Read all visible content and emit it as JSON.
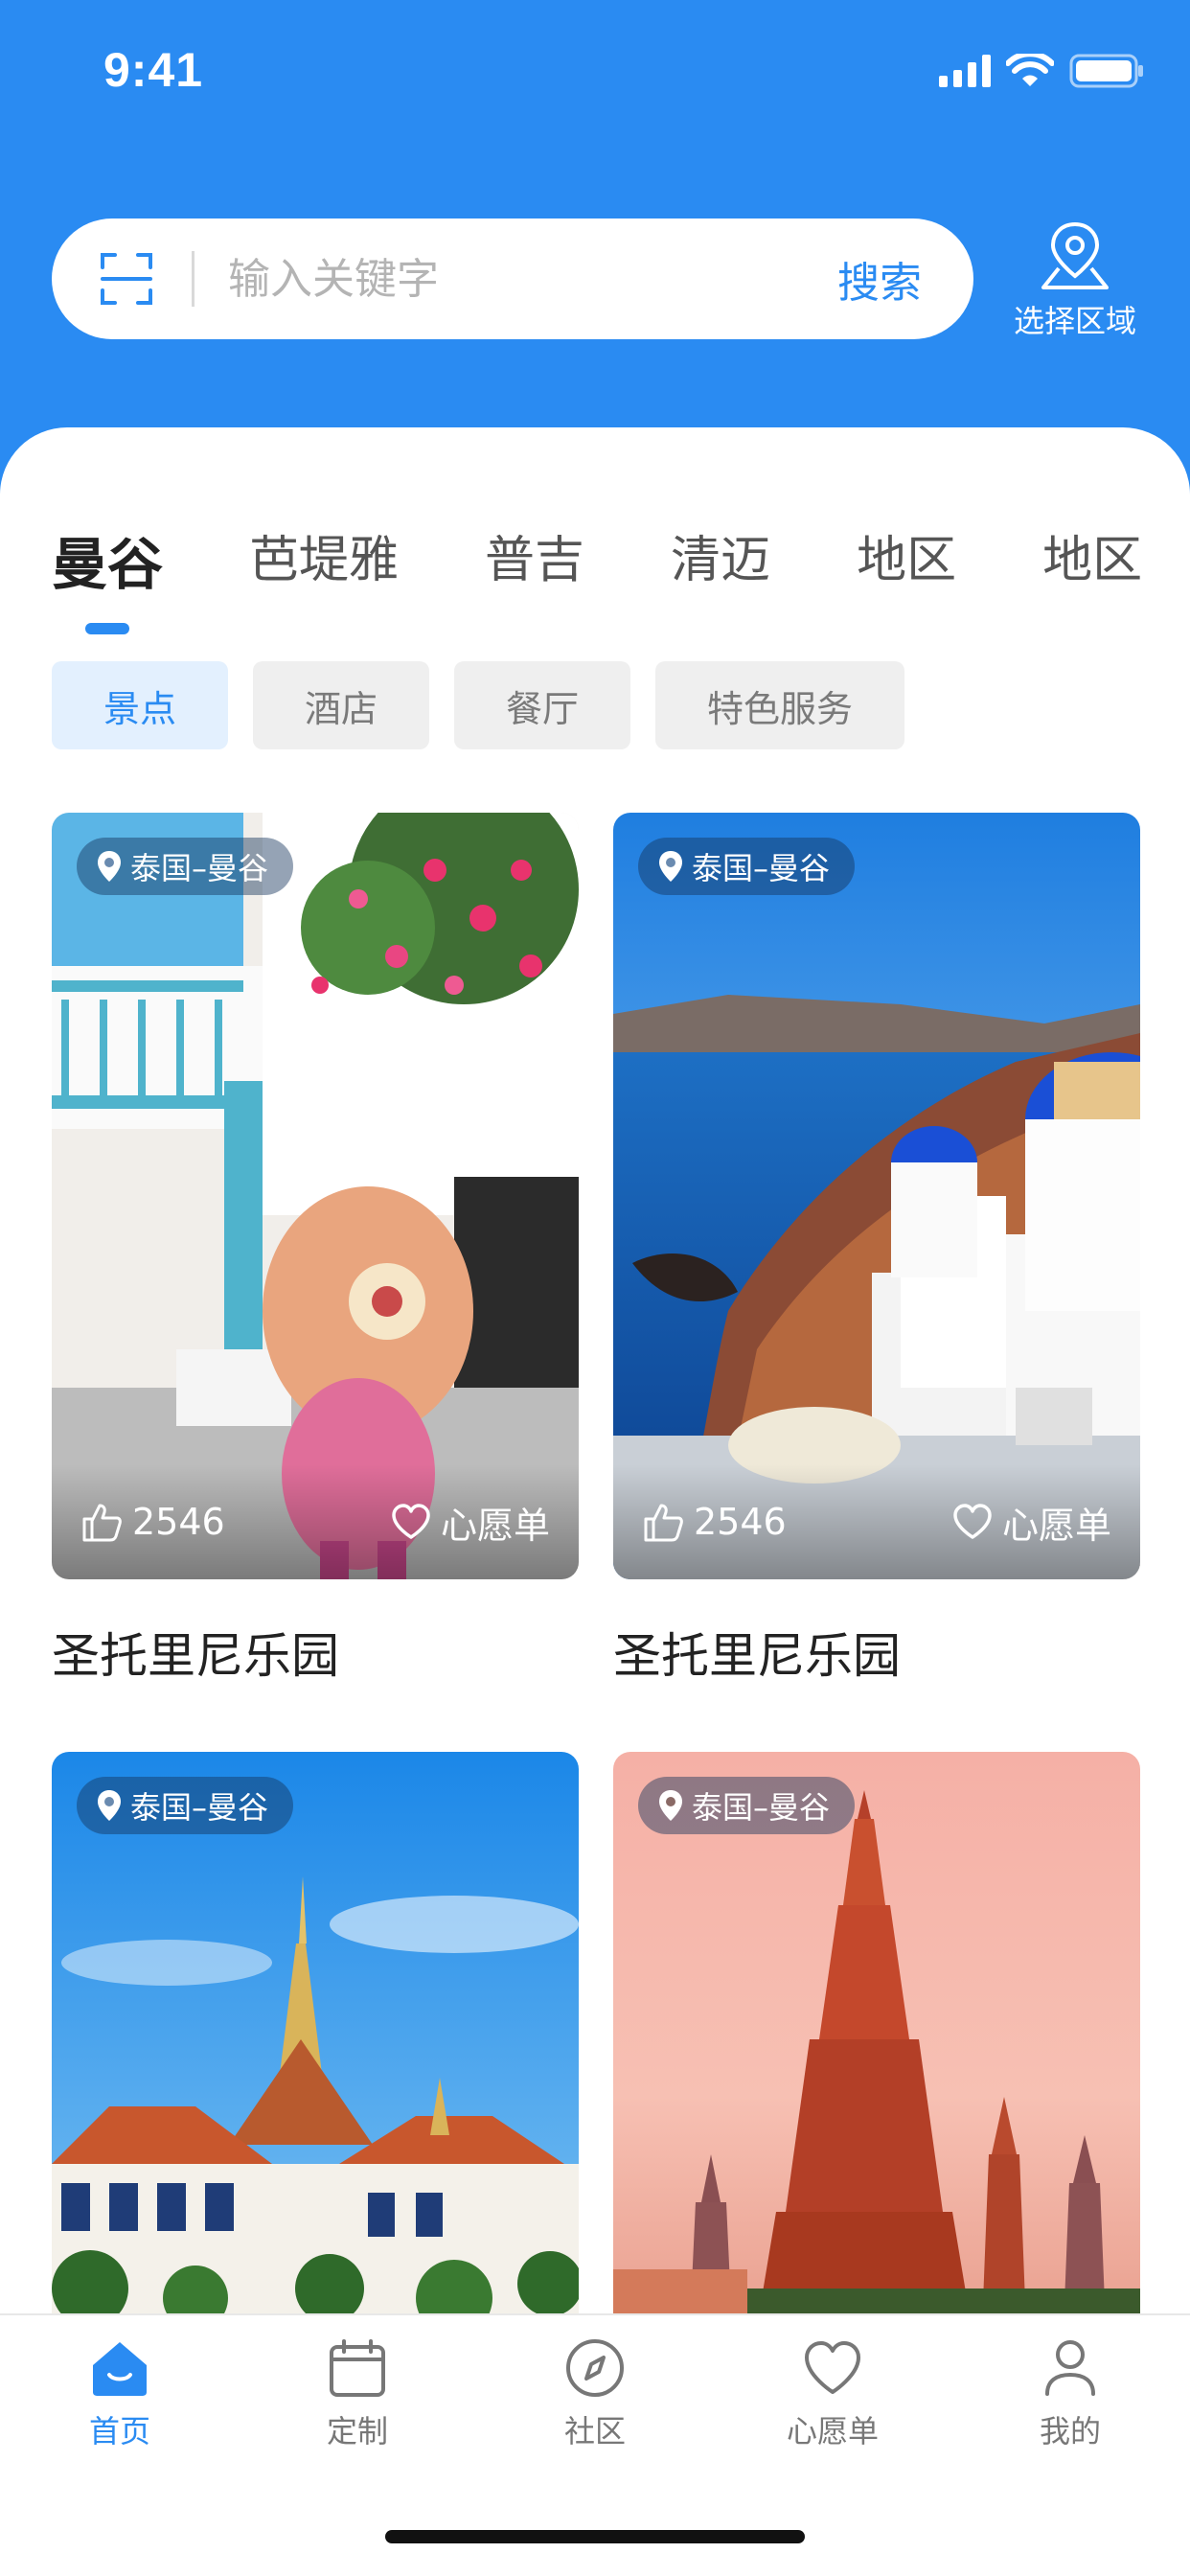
{
  "status_bar": {
    "time": "9:41"
  },
  "search": {
    "placeholder": "输入关键字",
    "button_label": "搜索",
    "value": ""
  },
  "region": {
    "label": "选择区域"
  },
  "city_tabs": [
    {
      "label": "曼谷",
      "active": true
    },
    {
      "label": "芭堤雅"
    },
    {
      "label": "普吉"
    },
    {
      "label": "清迈"
    },
    {
      "label": "地区"
    },
    {
      "label": "地区"
    }
  ],
  "category_chips": [
    {
      "label": "景点",
      "active": true
    },
    {
      "label": "酒店"
    },
    {
      "label": "餐厅"
    },
    {
      "label": "特色服务"
    }
  ],
  "cards": [
    {
      "location": "泰国–曼谷",
      "likes": "2546",
      "wish_label": "心愿单",
      "title": "圣托里尼乐园"
    },
    {
      "location": "泰国–曼谷",
      "likes": "2546",
      "wish_label": "心愿单",
      "title": "圣托里尼乐园"
    },
    {
      "location": "泰国–曼谷"
    },
    {
      "location": "泰国–曼谷"
    }
  ],
  "tab_bar": [
    {
      "label": "首页",
      "icon": "home-icon",
      "active": true
    },
    {
      "label": "定制",
      "icon": "calendar-icon"
    },
    {
      "label": "社区",
      "icon": "compass-icon"
    },
    {
      "label": "心愿单",
      "icon": "heart-icon"
    },
    {
      "label": "我的",
      "icon": "user-icon"
    }
  ],
  "colors": {
    "brand": "#2A8BF2",
    "chip_active_bg": "#E3F0FE"
  }
}
